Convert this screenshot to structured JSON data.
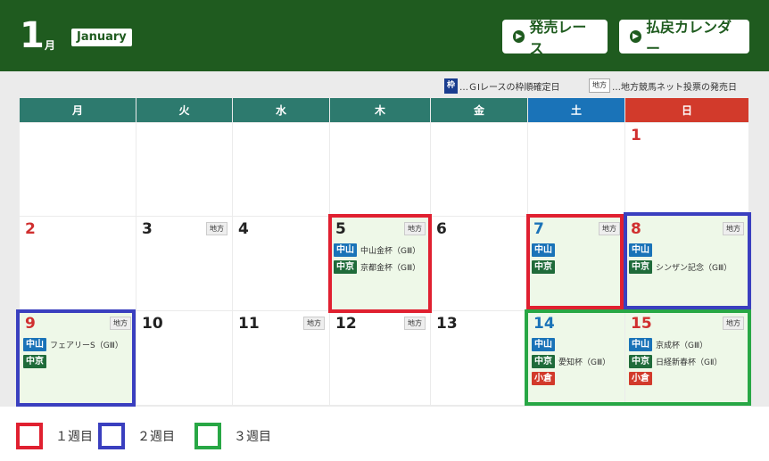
{
  "header": {
    "month_number": "1",
    "month_kanji": "月",
    "month_english": "January",
    "buttons": [
      {
        "label": "発売レース",
        "icon": "circle-arrow-right-icon"
      },
      {
        "label": "払戻カレンダー",
        "icon": "circle-arrow-right-icon"
      }
    ]
  },
  "legend_top": {
    "waku_badge": "枠",
    "waku_text": "…ＧⅠレースの枠順確定日",
    "chiho_badge": "地方",
    "chiho_text": "…地方競馬ネット投票の発売日"
  },
  "weekdays": [
    {
      "label": "月",
      "color": "#2d7a6e"
    },
    {
      "label": "火",
      "color": "#2d7a6e"
    },
    {
      "label": "水",
      "color": "#2d7a6e"
    },
    {
      "label": "木",
      "color": "#2d7a6e"
    },
    {
      "label": "金",
      "color": "#2d7a6e"
    },
    {
      "label": "土",
      "color": "#1a73b8"
    },
    {
      "label": "日",
      "color": "#d23a2b"
    }
  ],
  "venue_colors": {
    "中山": "#1a73b8",
    "中京": "#1f6b3a",
    "小倉": "#d23a2b"
  },
  "calendar": [
    {
      "row": 0,
      "col": 6,
      "day": "1",
      "color": "red"
    },
    {
      "row": 1,
      "col": 0,
      "day": "2",
      "color": "red"
    },
    {
      "row": 1,
      "col": 1,
      "day": "3",
      "chiho": "地方"
    },
    {
      "row": 1,
      "col": 2,
      "day": "4"
    },
    {
      "row": 1,
      "col": 3,
      "day": "5",
      "chiho": "地方",
      "highlight": true,
      "entries": [
        {
          "venue": "中山",
          "race": "中山金杯（GⅢ）"
        },
        {
          "venue": "中京",
          "race": "京都金杯（GⅢ）"
        }
      ]
    },
    {
      "row": 1,
      "col": 4,
      "day": "6"
    },
    {
      "row": 1,
      "col": 5,
      "day": "7",
      "color": "blue",
      "chiho": "地方",
      "highlight": true,
      "entries": [
        {
          "venue": "中山",
          "race": ""
        },
        {
          "venue": "中京",
          "race": ""
        }
      ]
    },
    {
      "row": 1,
      "col": 6,
      "day": "8",
      "color": "red",
      "chiho": "地方",
      "highlight": true,
      "entries": [
        {
          "venue": "中山",
          "race": ""
        },
        {
          "venue": "中京",
          "race": "シンザン記念（GⅢ）"
        }
      ]
    },
    {
      "row": 2,
      "col": 0,
      "day": "9",
      "color": "red",
      "chiho": "地方",
      "highlight": true,
      "entries": [
        {
          "venue": "中山",
          "race": "フェアリーS（GⅢ）"
        },
        {
          "venue": "中京",
          "race": ""
        }
      ]
    },
    {
      "row": 2,
      "col": 1,
      "day": "10"
    },
    {
      "row": 2,
      "col": 2,
      "day": "11",
      "chiho": "地方"
    },
    {
      "row": 2,
      "col": 3,
      "day": "12",
      "chiho": "地方"
    },
    {
      "row": 2,
      "col": 4,
      "day": "13"
    },
    {
      "row": 2,
      "col": 5,
      "day": "14",
      "color": "blue",
      "highlight": true,
      "entries": [
        {
          "venue": "中山",
          "race": ""
        },
        {
          "venue": "中京",
          "race": "愛知杯（GⅢ）"
        },
        {
          "venue": "小倉",
          "race": ""
        }
      ]
    },
    {
      "row": 2,
      "col": 6,
      "day": "15",
      "color": "red",
      "chiho": "地方",
      "highlight": true,
      "entries": [
        {
          "venue": "中山",
          "race": "京成杯（GⅢ）"
        },
        {
          "venue": "中京",
          "race": "日経新春杯（GⅡ）"
        },
        {
          "venue": "小倉",
          "race": ""
        }
      ]
    }
  ],
  "week_colors": {
    "week1": "#e02030",
    "week2": "#3a3fbf",
    "week3": "#28a745"
  },
  "bottom_legend": [
    {
      "label": "１週目",
      "color": "#e02030"
    },
    {
      "label": "２週目",
      "color": "#3a3fbf"
    },
    {
      "label": "３週目",
      "color": "#28a745"
    }
  ]
}
